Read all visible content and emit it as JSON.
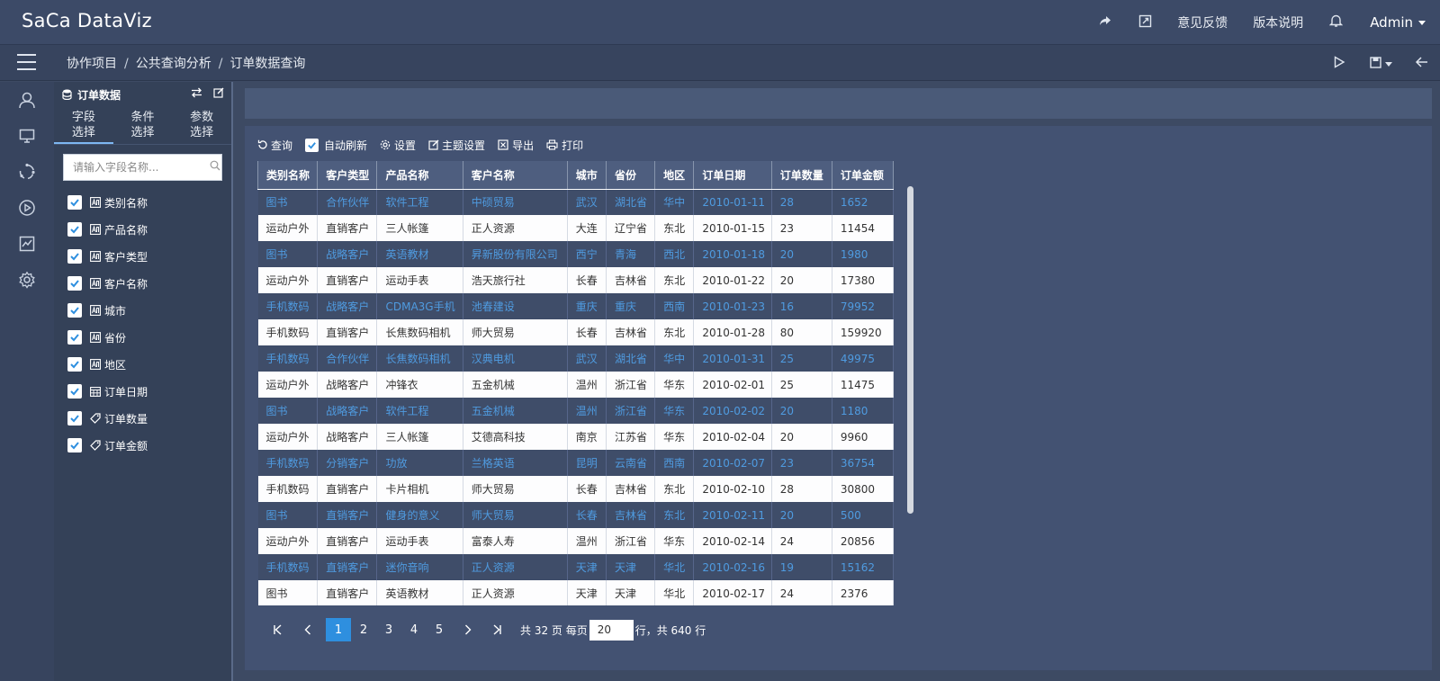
{
  "app": {
    "logo": "SaCa DataViz"
  },
  "header": {
    "feedback": "意见反馈",
    "version": "版本说明",
    "user": "Admin"
  },
  "breadcrumb": [
    "协作项目",
    "公共查询分析",
    "订单数据查询"
  ],
  "field_panel": {
    "title": "订单数据",
    "tabs": [
      "字段\n选择",
      "条件\n选择",
      "参数\n选择"
    ],
    "search_placeholder": "请输入字段名称...",
    "fields": [
      {
        "label": "类别名称",
        "type": "text"
      },
      {
        "label": "产品名称",
        "type": "text"
      },
      {
        "label": "客户类型",
        "type": "text"
      },
      {
        "label": "客户名称",
        "type": "text"
      },
      {
        "label": "城市",
        "type": "text"
      },
      {
        "label": "省份",
        "type": "text"
      },
      {
        "label": "地区",
        "type": "text"
      },
      {
        "label": "订单日期",
        "type": "date"
      },
      {
        "label": "订单数量",
        "type": "number"
      },
      {
        "label": "订单金额",
        "type": "number"
      }
    ]
  },
  "toolbar": {
    "query": "查询",
    "auto_refresh": "自动刷新",
    "settings": "设置",
    "theme_settings": "主题设置",
    "export": "导出",
    "print": "打印"
  },
  "table": {
    "columns": [
      "类别名称",
      "客户类型",
      "产品名称",
      "客户名称",
      "城市",
      "省份",
      "地区",
      "订单日期",
      "订单数量",
      "订单金额"
    ],
    "rows": [
      [
        "图书",
        "合作伙伴",
        "软件工程",
        "中硕贸易",
        "武汉",
        "湖北省",
        "华中",
        "2010-01-11",
        "28",
        "1652"
      ],
      [
        "运动户外",
        "直销客户",
        "三人帐篷",
        "正人资源",
        "大连",
        "辽宁省",
        "东北",
        "2010-01-15",
        "23",
        "11454"
      ],
      [
        "图书",
        "战略客户",
        "英语教材",
        "昇新股份有限公司",
        "西宁",
        "青海",
        "西北",
        "2010-01-18",
        "20",
        "1980"
      ],
      [
        "运动户外",
        "直销客户",
        "运动手表",
        "浩天旅行社",
        "长春",
        "吉林省",
        "东北",
        "2010-01-22",
        "20",
        "17380"
      ],
      [
        "手机数码",
        "战略客户",
        "CDMA3G手机",
        "池春建设",
        "重庆",
        "重庆",
        "西南",
        "2010-01-23",
        "16",
        "79952"
      ],
      [
        "手机数码",
        "直销客户",
        "长焦数码相机",
        "师大贸易",
        "长春",
        "吉林省",
        "东北",
        "2010-01-28",
        "80",
        "159920"
      ],
      [
        "手机数码",
        "合作伙伴",
        "长焦数码相机",
        "汉典电机",
        "武汉",
        "湖北省",
        "华中",
        "2010-01-31",
        "25",
        "49975"
      ],
      [
        "运动户外",
        "战略客户",
        "冲锋衣",
        "五金机械",
        "温州",
        "浙江省",
        "华东",
        "2010-02-01",
        "25",
        "11475"
      ],
      [
        "图书",
        "战略客户",
        "软件工程",
        "五金机械",
        "温州",
        "浙江省",
        "华东",
        "2010-02-02",
        "20",
        "1180"
      ],
      [
        "运动户外",
        "战略客户",
        "三人帐篷",
        "艾德高科技",
        "南京",
        "江苏省",
        "华东",
        "2010-02-04",
        "20",
        "9960"
      ],
      [
        "手机数码",
        "分销客户",
        "功放",
        "兰格英语",
        "昆明",
        "云南省",
        "西南",
        "2010-02-07",
        "23",
        "36754"
      ],
      [
        "手机数码",
        "直销客户",
        "卡片相机",
        "师大贸易",
        "长春",
        "吉林省",
        "东北",
        "2010-02-10",
        "28",
        "30800"
      ],
      [
        "图书",
        "直销客户",
        "健身的意义",
        "师大贸易",
        "长春",
        "吉林省",
        "东北",
        "2010-02-11",
        "20",
        "500"
      ],
      [
        "运动户外",
        "直销客户",
        "运动手表",
        "富泰人寿",
        "温州",
        "浙江省",
        "华东",
        "2010-02-14",
        "24",
        "20856"
      ],
      [
        "手机数码",
        "直销客户",
        "迷你音响",
        "正人资源",
        "天津",
        "天津",
        "华北",
        "2010-02-16",
        "19",
        "15162"
      ],
      [
        "图书",
        "直销客户",
        "英语教材",
        "正人资源",
        "天津",
        "天津",
        "华北",
        "2010-02-17",
        "24",
        "2376"
      ]
    ]
  },
  "pagination": {
    "pages": [
      "1",
      "2",
      "3",
      "4",
      "5"
    ],
    "current": "1",
    "total_text": "共 32 页 每页",
    "page_size": "20",
    "rows_text": "行，共 640 行"
  },
  "colors": {
    "accent": "#2e8fdf",
    "link": "#4f9be0",
    "bg": "#3d4a63"
  }
}
